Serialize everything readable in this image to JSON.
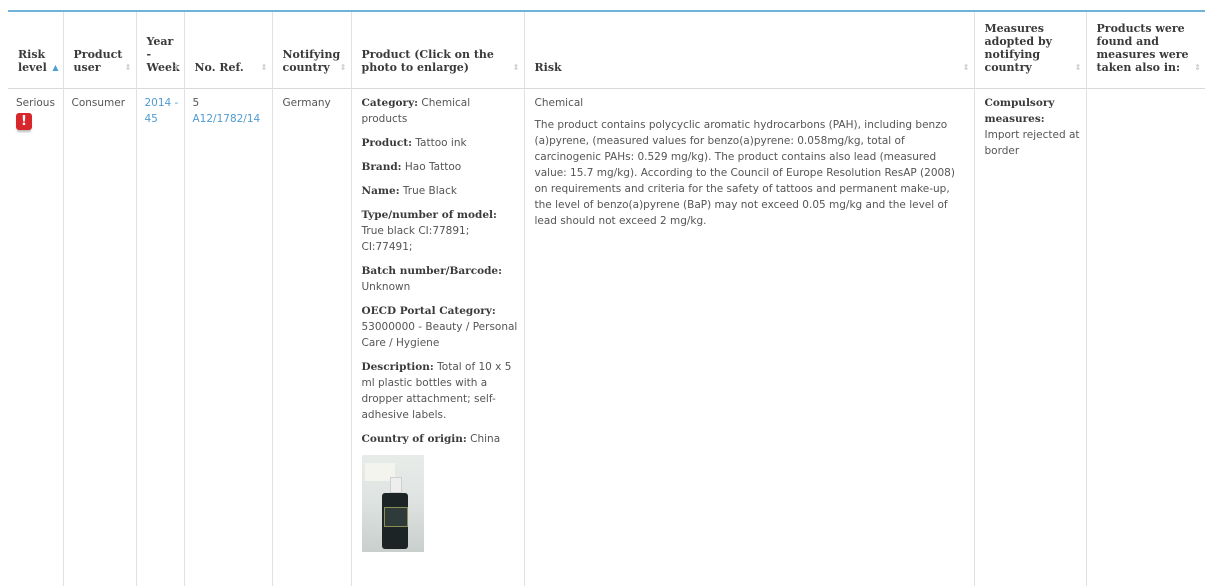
{
  "headers": {
    "risk_level": "Risk level",
    "product_user": "Product user",
    "year_week": "Year - Week",
    "no_ref": "No. Ref.",
    "notifying_country": "Notifying country",
    "product": "Product (Click on the photo to enlarge)",
    "risk": "Risk",
    "measures": "Measures adopted by notifying country",
    "products_found": "Products were found and measures were taken also in:"
  },
  "row": {
    "risk_level": "Serious",
    "product_user": "Consumer",
    "year_week": "2014 - 45",
    "no": "5",
    "ref": "A12/1782/14",
    "notifying_country": "Germany",
    "product": {
      "category_label": "Category:",
      "category": "Chemical products",
      "product_label": "Product:",
      "product": "Tattoo ink",
      "brand_label": "Brand:",
      "brand": "Hao Tattoo",
      "name_label": "Name:",
      "name": "True Black",
      "model_label": "Type/number of model:",
      "model": "True black CI:77891; CI:77491;",
      "batch_label": "Batch number/Barcode:",
      "batch": "Unknown",
      "oecd_label": "OECD Portal Category:",
      "oecd": "53000000 - Beauty / Personal Care / Hygiene",
      "description_label": "Description:",
      "description": "Total of 10 x 5 ml plastic bottles with a dropper attachment; self-adhesive labels.",
      "origin_label": "Country of origin:",
      "origin": "China"
    },
    "risk_type": "Chemical",
    "risk_description": "The product contains polycyclic aromatic hydrocarbons (PAH), including benzo (a)pyrene, (measured values for benzo(a)pyrene: 0.058mg/kg, total of carcinogenic PAHs: 0.529 mg/kg). The product contains also lead (measured value: 15.7 mg/kg). According to the Council of Europe Resolution ResAP (2008) on requirements and criteria for the safety of tattoos and permanent make-up, the level of benzo(a)pyrene (BaP) may not exceed 0.05 mg/kg and the level of lead should not exceed 2 mg/kg.",
    "measures_label": "Compulsory measures:",
    "measures": "Import rejected at border",
    "products_found": ""
  },
  "icons": {
    "sort_active": "sort-ascending-icon",
    "sort": "sort-icon",
    "risk": "serious-risk-alert-icon"
  },
  "colors": {
    "accent_line": "#6fb3d9",
    "link": "#4f9bd1",
    "serious": "#d7272c"
  }
}
